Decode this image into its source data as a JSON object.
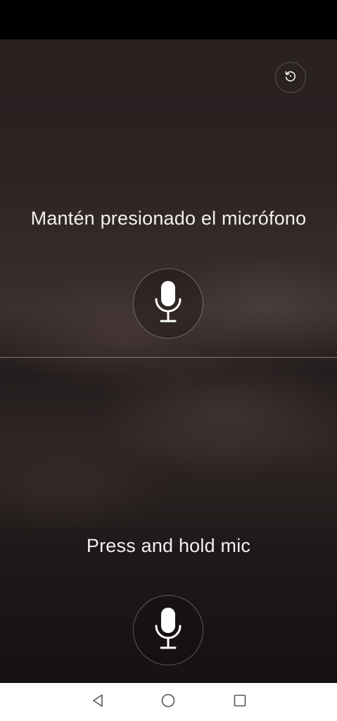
{
  "top_panel": {
    "prompt": "Mantén presionado el micrófono",
    "mic_icon": "microphone-icon"
  },
  "bottom_panel": {
    "prompt": "Press and hold mic",
    "mic_icon": "microphone-icon"
  },
  "toolbar": {
    "reset_icon": "rotate-ccw-icon"
  },
  "navigation_bar": {
    "back_icon": "back-triangle-icon",
    "home_icon": "home-circle-icon",
    "recents_icon": "recents-square-icon"
  },
  "colors": {
    "background": "#2a2221",
    "text": "#f2f0ef",
    "nav_bar": "#ffffff",
    "nav_icon": "#555555"
  }
}
